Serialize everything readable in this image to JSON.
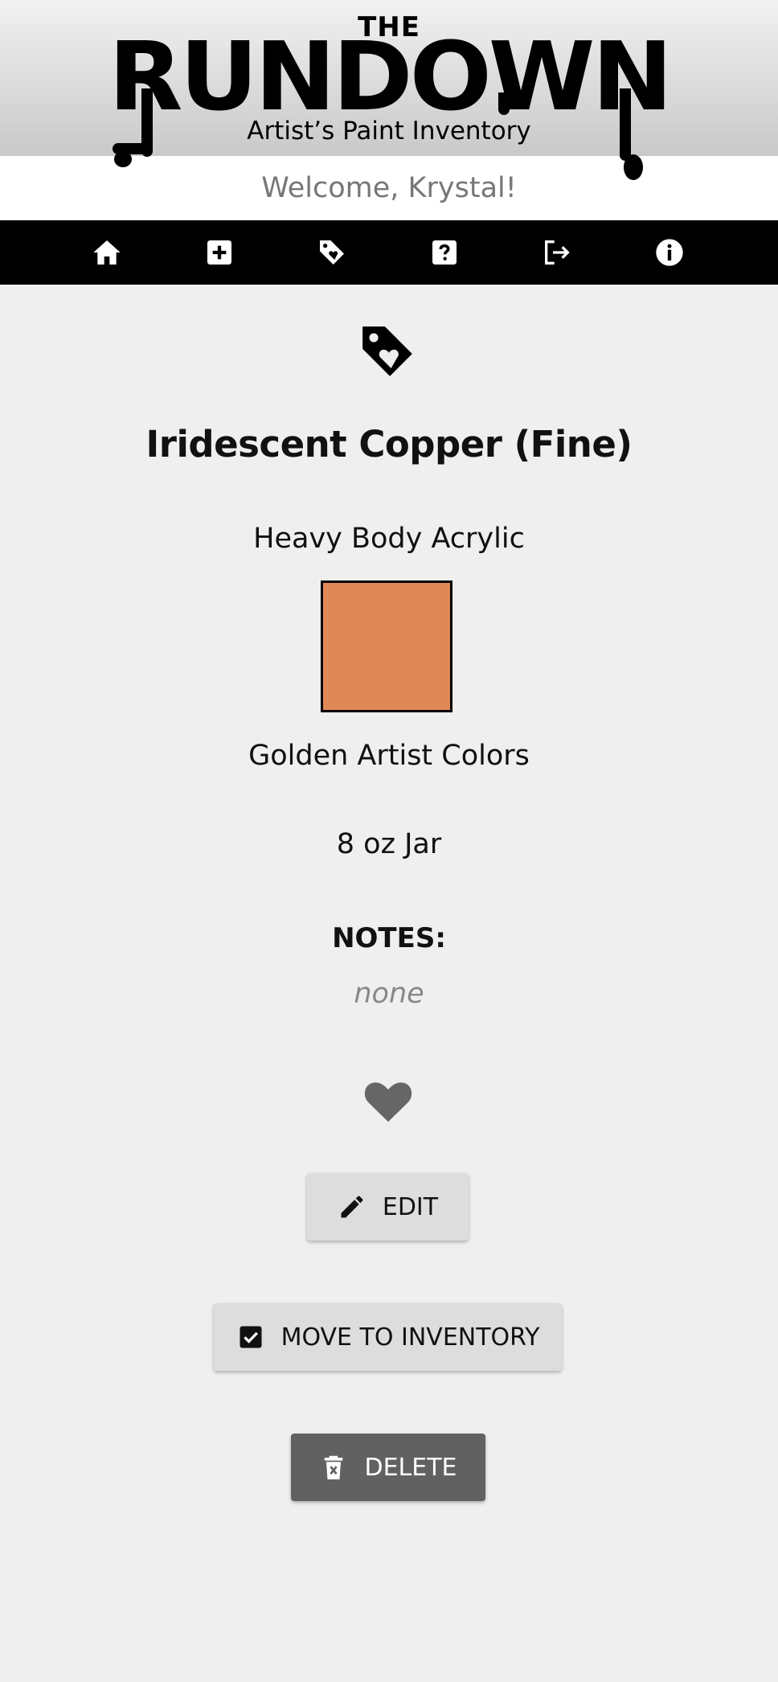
{
  "header": {
    "logo_the": "THE",
    "logo_main": "RUNDOWN",
    "logo_sub": "Artist’s Paint Inventory",
    "welcome": "Welcome, Krystal!"
  },
  "nav": {
    "items": [
      {
        "icon": "home-icon"
      },
      {
        "icon": "add-icon"
      },
      {
        "icon": "wishlist-tag-icon"
      },
      {
        "icon": "help-icon"
      },
      {
        "icon": "logout-icon"
      },
      {
        "icon": "info-icon"
      }
    ]
  },
  "paint": {
    "name": "Iridescent Copper (Fine)",
    "type": "Heavy Body Acrylic",
    "swatch_color": "#e08958",
    "brand": "Golden Artist Colors",
    "size": "8 oz Jar",
    "notes_label": "NOTES:",
    "notes_value": "none"
  },
  "actions": {
    "edit_label": "EDIT",
    "move_label": "MOVE TO INVENTORY",
    "delete_label": "DELETE"
  },
  "colors": {
    "header_bar": "#000000",
    "button_light": "#dddddd",
    "button_dark": "#616161",
    "heart": "#666666"
  }
}
